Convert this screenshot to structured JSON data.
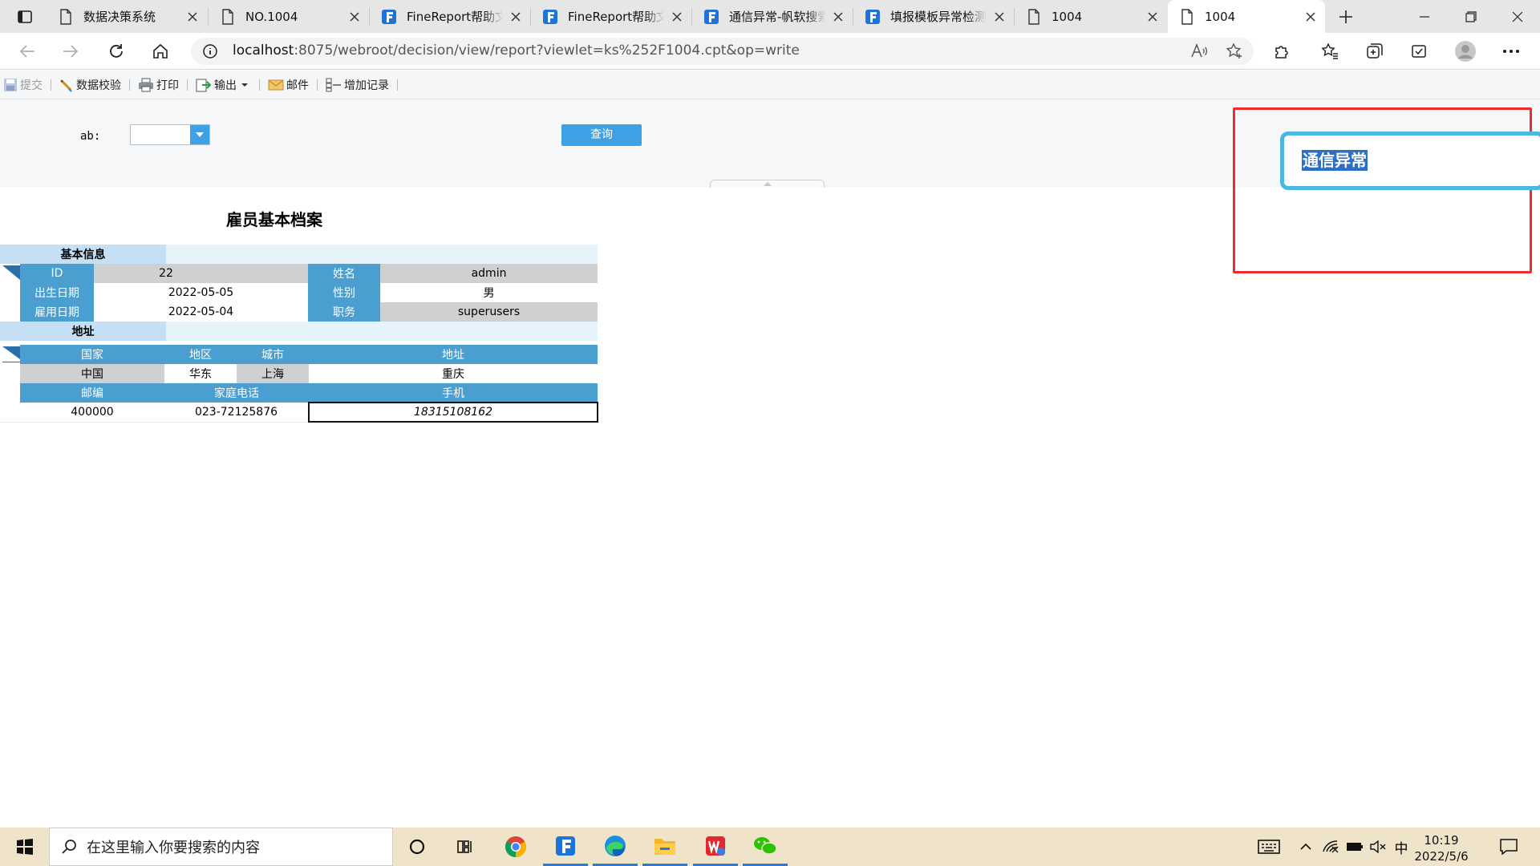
{
  "browser": {
    "tabs": [
      {
        "title": "数据决策系统",
        "icon": "page-icon"
      },
      {
        "title": "NO.1004",
        "icon": "page-icon"
      },
      {
        "title": "FineReport帮助文档",
        "icon": "finereport-icon"
      },
      {
        "title": "FineReport帮助文档",
        "icon": "finereport-icon"
      },
      {
        "title": "通信异常-帆软搜索",
        "icon": "finereport-icon"
      },
      {
        "title": "填报模板异常检测",
        "icon": "finereport-icon"
      },
      {
        "title": "1004",
        "icon": "page-icon"
      },
      {
        "title": "1004",
        "icon": "page-icon",
        "active": true
      }
    ],
    "url_host": "localhost",
    "url_path": ":8075/webroot/decision/view/report?viewlet=ks%252F1004.cpt&op=write"
  },
  "toolbar": {
    "submit": "提交",
    "validate": "数据校验",
    "print": "打印",
    "export": "输出",
    "email": "邮件",
    "add_record": "增加记录"
  },
  "params": {
    "ab_label": "ab:",
    "ab_value": "",
    "query_label": "查询"
  },
  "report": {
    "title": "雇员基本档案",
    "basic_section": "基本信息",
    "id_label": "ID",
    "id_value": "22",
    "name_label": "姓名",
    "name_value": "admin",
    "birth_label": "出生日期",
    "birth_value": "2022-05-05",
    "gender_label": "性别",
    "gender_value": "男",
    "hire_label": "雇用日期",
    "hire_value": "2022-05-04",
    "job_label": "职务",
    "job_value": "superusers",
    "address_section": "地址",
    "country_label": "国家",
    "region_label": "地区",
    "city_label": "城市",
    "address_label": "地址",
    "country_value": "中国",
    "region_value": "华东",
    "city_value": "上海",
    "address_value": "重庆",
    "zip_label": "邮编",
    "home_phone_label": "家庭电话",
    "mobile_label": "手机",
    "zip_value": "400000",
    "home_phone_value": "023-72125876",
    "mobile_value": "18315108162"
  },
  "notification": {
    "message": "通信异常"
  },
  "taskbar": {
    "search_placeholder": "在这里输入你要搜索的内容",
    "time": "10:19",
    "date": "2022/5/6",
    "ime": "中"
  },
  "colors": {
    "accent": "#3ea1e6",
    "cell_blue": "#4b9fd0",
    "alert_red": "#ec2c2c"
  }
}
